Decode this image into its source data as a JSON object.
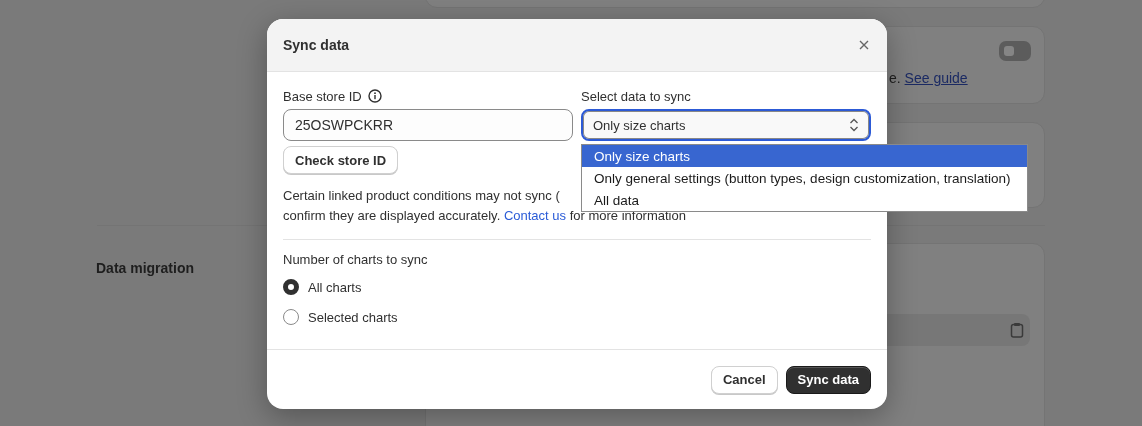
{
  "background": {
    "section_label": "Data migration",
    "guide_text": "e.",
    "guide_link": "See guide",
    "toggle": {
      "on": false
    }
  },
  "dialog": {
    "title": "Sync data",
    "store_id": {
      "label": "Base store ID",
      "value": "25OSWPCKRR"
    },
    "check_button": "Check store ID",
    "select": {
      "label": "Select data to sync",
      "value": "Only size charts",
      "options": [
        {
          "label": "Only size charts",
          "selected": true
        },
        {
          "label": "Only general settings (button types, design customization, translation)",
          "selected": false
        },
        {
          "label": "All data",
          "selected": false
        }
      ]
    },
    "description": {
      "line_1": "Certain linked product conditions may not sync (",
      "line_2": "confirm they are displayed accurately. ",
      "link": "Contact us",
      "line_2_end": " for more information"
    },
    "charts": {
      "label": "Number of charts to sync",
      "options": [
        {
          "label": "All charts",
          "selected": true
        },
        {
          "label": "Selected charts",
          "selected": false
        }
      ]
    },
    "buttons": [
      {
        "label": "Cancel",
        "kind": "secondary"
      },
      {
        "label": "Sync data",
        "kind": "primary"
      }
    ]
  }
}
